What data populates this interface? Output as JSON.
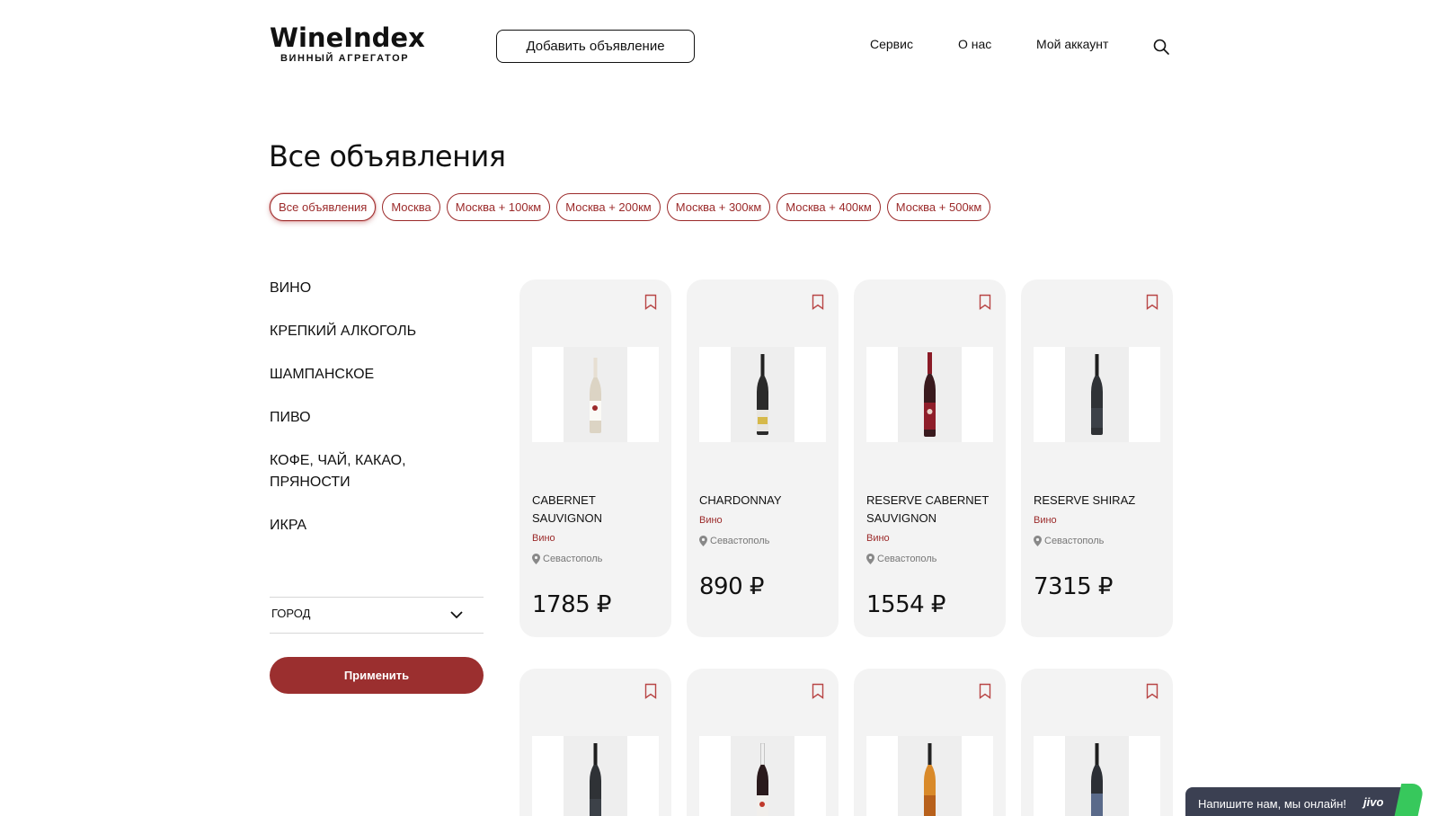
{
  "header": {
    "logo_main": "WineIndex",
    "logo_sub": "ВИННЫЙ АГРЕГАТОР",
    "add_listing": "Добавить объявление",
    "nav": [
      "Сервис",
      "О нас",
      "Мой аккаунт"
    ]
  },
  "page_title": "Все объявления",
  "filters": [
    "Все объявления",
    "Москва",
    "Москва + 100км",
    "Москва + 200км",
    "Москва + 300км",
    "Москва + 400км",
    "Москва + 500км"
  ],
  "active_filter": "Все объявления",
  "categories": [
    "ВИНО",
    "КРЕПКИЙ АЛКОГОЛЬ",
    "ШАМПАНСКОЕ",
    "ПИВО",
    "КОФЕ, ЧАЙ, КАКАО, ПРЯНОСТИ",
    "ИКРА"
  ],
  "city_filter": {
    "label": "ГОРОД"
  },
  "apply_label": "Применить",
  "products": [
    {
      "name": "CABERNET SAUVIGNON",
      "category": "Вино",
      "city": "Севастополь",
      "price": "1785 ₽"
    },
    {
      "name": "CHARDONNAY",
      "category": "Вино",
      "city": "Севастополь",
      "price": "890 ₽"
    },
    {
      "name": "RESERVE CABERNET SAUVIGNON",
      "category": "Вино",
      "city": "Севастополь",
      "price": "1554 ₽"
    },
    {
      "name": "RESERVE SHIRAZ",
      "category": "Вино",
      "city": "Севастополь",
      "price": "7315 ₽"
    }
  ],
  "chat": {
    "text": "Напишите нам, мы онлайн!",
    "brand": "jivo"
  },
  "colors": {
    "accent": "#9b2f2f",
    "card_bg": "#f3f3f3",
    "chat_bg": "#3b4052",
    "chat_accent": "#37c85c"
  },
  "icons": {
    "search": "search-icon",
    "bookmark": "bookmark-icon",
    "pin": "pin-icon",
    "chevron": "chevron-down-icon"
  }
}
